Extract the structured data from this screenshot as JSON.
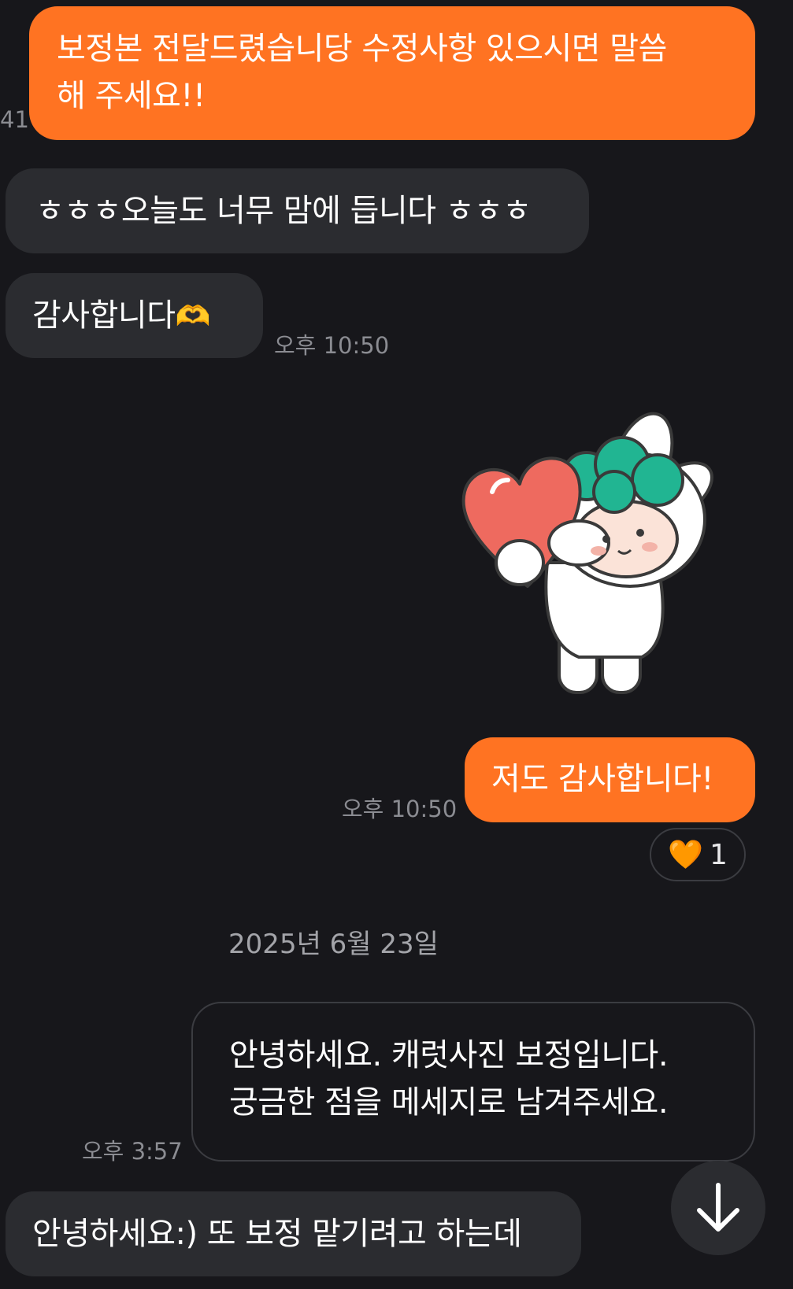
{
  "messages": [
    {
      "id": "m1",
      "text_line1": "보정본 전달드렸습니당 수정사항 있으시면 말씀",
      "text_line2": "해 주세요!!",
      "side": "out",
      "time_fragment": "41"
    },
    {
      "id": "m2",
      "text": "ㅎㅎㅎ오늘도 너무 맘에 듭니다 ㅎㅎㅎ",
      "side": "in"
    },
    {
      "id": "m3",
      "text": "감사합니다",
      "emoji": "🫶",
      "side": "in",
      "time": "오후 10:50"
    },
    {
      "id": "m4",
      "type": "sticker",
      "sticker_name": "bunny-with-heart-sticker",
      "side": "in"
    },
    {
      "id": "m5",
      "text": "저도 감사합니다!",
      "side": "out",
      "time": "오후 10:50",
      "reaction": {
        "emoji": "🧡",
        "count": "1"
      }
    },
    {
      "id": "m6",
      "text_line1": "안녕하세요. 캐럿사진 보정입니다.",
      "text_line2": "궁금한 점을 메세지로 남겨주세요.",
      "side": "out-outlined",
      "time": "오후 3:57"
    },
    {
      "id": "m7",
      "text": "안녕하세요:) 또 보정 맡기려고 하는데",
      "side": "in"
    }
  ],
  "date_divider": "2025년 6월 23일",
  "scroll_down_icon": "arrow-down-icon",
  "colors": {
    "background": "#17171b",
    "outgoing": "#ff7322",
    "incoming": "#2b2c30",
    "timestamp": "#8b8c92",
    "sticker_green": "#21b592",
    "sticker_heart": "#ee6a5f"
  }
}
